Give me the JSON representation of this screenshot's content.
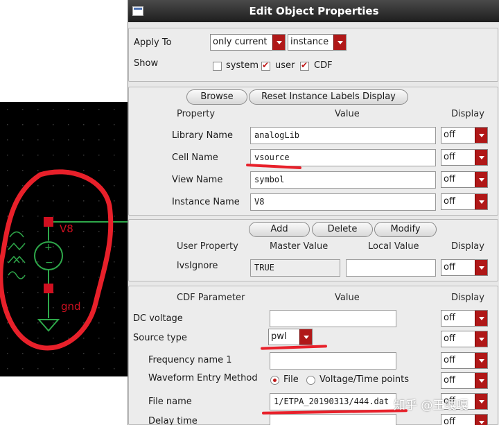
{
  "schematic": {
    "instance_label": "V8",
    "ground_label": "gnd",
    "colors": {
      "background": "#000000",
      "wire": "#2ea84a",
      "pin": "#d01020",
      "label": "#d01020",
      "annotation": "#e8202a"
    }
  },
  "dialog": {
    "title": "Edit Object Properties",
    "apply_to": {
      "label": "Apply To",
      "scope_value": "only current",
      "type_value": "instance"
    },
    "show": {
      "label": "Show",
      "system_label": "system",
      "system_checked": false,
      "user_label": "user",
      "user_checked": true,
      "cdf_label": "CDF",
      "cdf_checked": true
    },
    "instance_section": {
      "browse_button": "Browse",
      "reset_button": "Reset Instance Labels Display",
      "headers": {
        "property": "Property",
        "value": "Value",
        "display": "Display"
      },
      "rows": [
        {
          "label": "Library Name",
          "value": "analogLib",
          "display": "off"
        },
        {
          "label": "Cell Name",
          "value": "vsource",
          "display": "off"
        },
        {
          "label": "View Name",
          "value": "symbol",
          "display": "off"
        },
        {
          "label": "Instance Name",
          "value": "V8",
          "display": "off"
        }
      ]
    },
    "user_section": {
      "add_button": "Add",
      "delete_button": "Delete",
      "modify_button": "Modify",
      "headers": {
        "user_property": "User Property",
        "master_value": "Master Value",
        "local_value": "Local Value",
        "display": "Display"
      },
      "rows": [
        {
          "label": "lvsIgnore",
          "master_value": "TRUE",
          "local_value": "",
          "display": "off"
        }
      ]
    },
    "cdf_section": {
      "headers": {
        "parameter": "CDF Parameter",
        "value": "Value",
        "display": "Display"
      },
      "dc_voltage": {
        "label": "DC voltage",
        "value": "",
        "display": "off"
      },
      "source_type": {
        "label": "Source type",
        "value": "pwl",
        "display": "off"
      },
      "frequency_name": {
        "label": "Frequency name 1",
        "value": "",
        "display": "off"
      },
      "waveform_method": {
        "label": "Waveform Entry Method",
        "option_file": "File",
        "option_points": "Voltage/Time points",
        "selected": "File",
        "display": "off"
      },
      "file_name": {
        "label": "File name",
        "value": "1/ETPA_20190313/444.dat",
        "display": "off"
      },
      "delay_time": {
        "label": "Delay time",
        "value": "",
        "display": "off"
      }
    }
  },
  "watermark": "知乎 @王嘎嘎",
  "annotation_color": "#e8202a"
}
